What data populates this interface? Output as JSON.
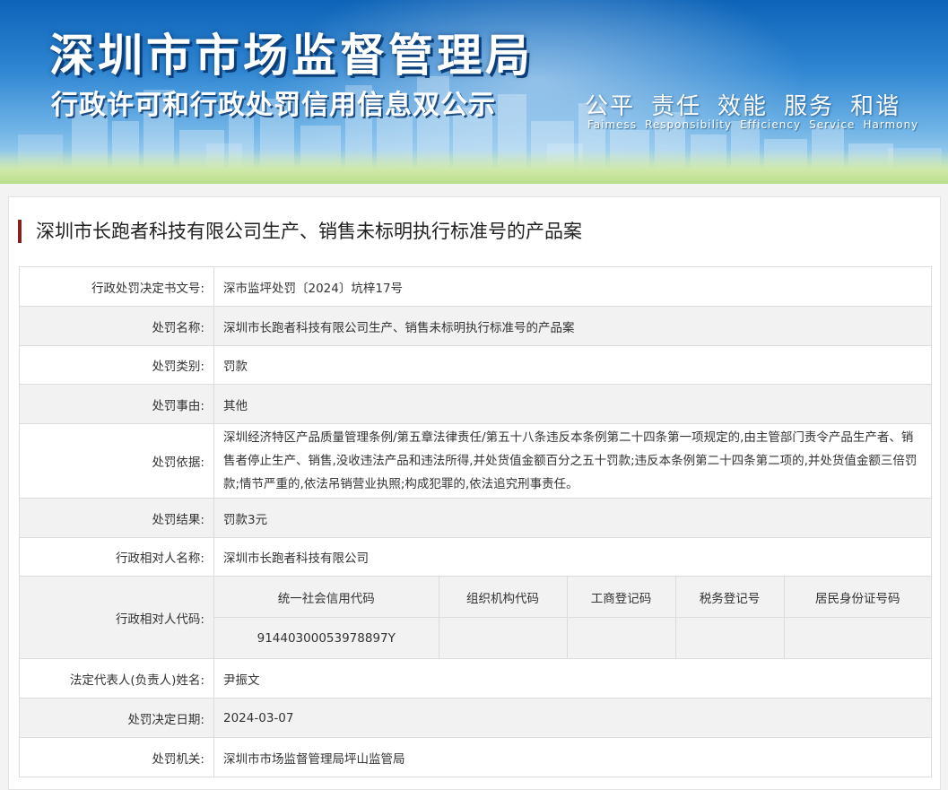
{
  "banner": {
    "title": "深圳市市场监督管理局",
    "subtitle": "行政许可和行政处罚信用信息双公示",
    "slogan": [
      "公平",
      "责任",
      "效能",
      "服务",
      "和谐"
    ],
    "slogan_en": [
      "Faimess",
      "Responsibility",
      "Efficiency",
      "Service",
      "Harmony"
    ]
  },
  "case_title": "深圳市长跑者科技有限公司生产、销售未标明执行标准号的产品案",
  "details": {
    "decision_no": {
      "label": "行政处罚决定书文号:",
      "value": "深市监坪处罚〔2024〕坑梓17号"
    },
    "penalty_name": {
      "label": "处罚名称:",
      "value": "深圳市长跑者科技有限公司生产、销售未标明执行标准号的产品案"
    },
    "penalty_type": {
      "label": "处罚类别:",
      "value": "罚款"
    },
    "penalty_reason": {
      "label": "处罚事由:",
      "value": "其他"
    },
    "penalty_basis": {
      "label": "处罚依据:",
      "value": "深圳经济特区产品质量管理条例/第五章法律责任/第五十八条违反本条例第二十四条第一项规定的,由主管部门责令产品生产者、销售者停止生产、销售,没收违法产品和违法所得,并处货值金额百分之五十罚款;违反本条例第二十四条第二项的,并处货值金额三倍罚款;情节严重的,依法吊销营业执照;构成犯罪的,依法追究刑事责任。"
    },
    "penalty_result": {
      "label": "处罚结果:",
      "value": "罚款3元"
    },
    "counterpart_name": {
      "label": "行政相对人名称:",
      "value": "深圳市长跑者科技有限公司"
    },
    "counterpart_code": {
      "label": "行政相对人代码:",
      "headers": [
        "统一社会信用代码",
        "组织机构代码",
        "工商登记码",
        "税务登记号",
        "居民身份证号码"
      ],
      "values": [
        "91440300053978897Y",
        "",
        "",
        "",
        ""
      ]
    },
    "legal_rep": {
      "label": "法定代表人(负责人)姓名:",
      "value": "尹振文"
    },
    "decision_date": {
      "label": "处罚决定日期:",
      "value": "2024-03-07"
    },
    "authority": {
      "label": "处罚机关:",
      "value": "深圳市市场监督管理局坪山监管局"
    }
  }
}
